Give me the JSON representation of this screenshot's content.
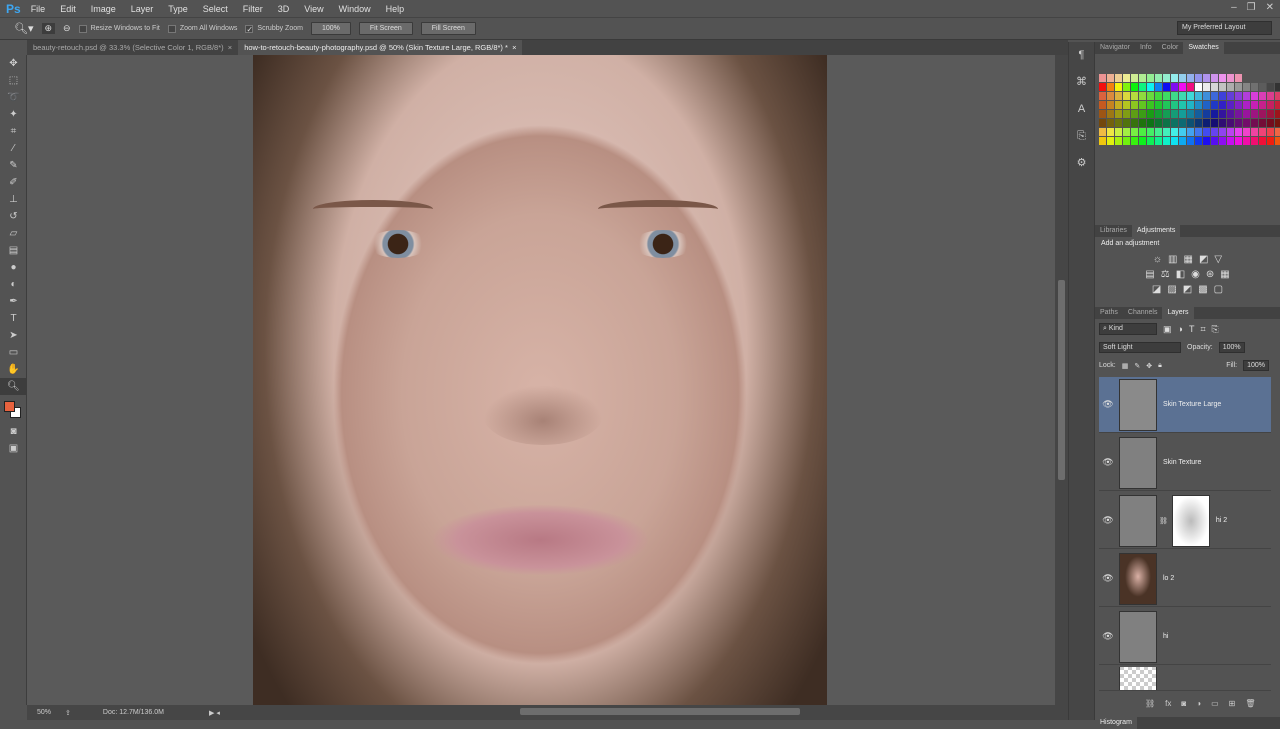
{
  "app": {
    "logo": "Ps"
  },
  "menu": [
    "File",
    "Edit",
    "Image",
    "Layer",
    "Type",
    "Select",
    "Filter",
    "3D",
    "View",
    "Window",
    "Help"
  ],
  "options": {
    "resize_windows": "Resize Windows to Fit",
    "zoom_all": "Zoom All Windows",
    "scrubby_zoom": "Scrubby Zoom",
    "scrubby_checked": "✓",
    "btn_100": "100%",
    "btn_fit": "Fit Screen",
    "btn_fill": "Fill Screen",
    "workspace": "My Preferred Layout"
  },
  "tabs": [
    {
      "label": "beauty-retouch.psd @ 33.3% (Selective Color 1, RGB/8*)",
      "close": "×"
    },
    {
      "label": "how-to-retouch-beauty-photography.psd @ 50% (Skin Texture Large, RGB/8*) *",
      "close": "×"
    }
  ],
  "status": {
    "zoom": "50%",
    "doc": "Doc: 12.7M/136.0M"
  },
  "panels": {
    "top_tabs": [
      "Navigator",
      "Info",
      "Color",
      "Swatches"
    ],
    "adj_tabs": [
      "Libraries",
      "Adjustments"
    ],
    "adj_title": "Add an adjustment",
    "layer_tabs": [
      "Paths",
      "Channels",
      "Layers"
    ],
    "kind": "Kind",
    "blend": "Soft Light",
    "opacity_label": "Opacity:",
    "opacity": "100%",
    "lock_label": "Lock:",
    "fill_label": "Fill:",
    "fill": "100%",
    "layers": [
      {
        "name": "Skin Texture Large"
      },
      {
        "name": "Skin Texture"
      },
      {
        "name": "hi 2"
      },
      {
        "name": "lo 2"
      },
      {
        "name": "hi"
      },
      {
        "name": ""
      }
    ],
    "histogram": "Histogram"
  }
}
